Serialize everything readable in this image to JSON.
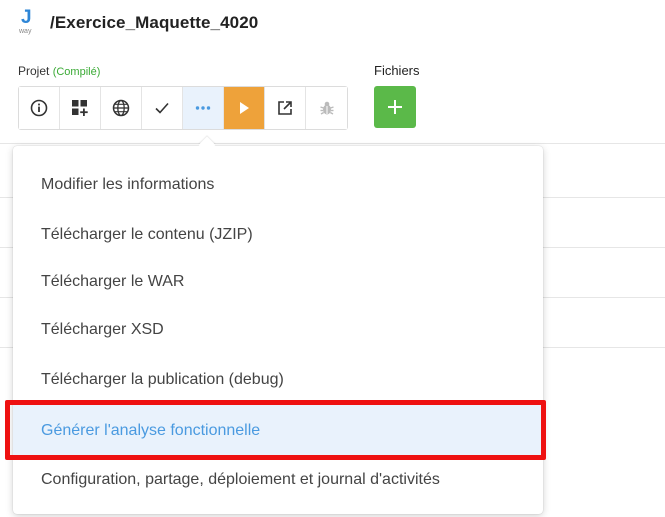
{
  "header": {
    "logo_letter": "J",
    "logo_sub": "way",
    "title": "/Exercice_Maquette_4020"
  },
  "sections": {
    "projet_label": "Projet",
    "projet_status": "(Compilé)",
    "fichiers_label": "Fichiers"
  },
  "toolbar": {
    "buttons": [
      {
        "icon": "info-icon"
      },
      {
        "icon": "add-widget-icon"
      },
      {
        "icon": "globe-icon"
      },
      {
        "icon": "checkmark-icon"
      },
      {
        "icon": "more-icon",
        "active": true
      },
      {
        "icon": "play-icon"
      },
      {
        "icon": "open-external-icon"
      },
      {
        "icon": "bug-icon",
        "disabled": true
      }
    ]
  },
  "fichiers": {
    "add_icon": "plus-icon"
  },
  "menu": {
    "items": [
      "Modifier les informations",
      "Télécharger le contenu (JZIP)",
      "Télécharger le WAR",
      "Télécharger XSD",
      "Télécharger la publication (debug)",
      "Générer l'analyse fonctionnelle",
      "Configuration, partage, déploiement et journal d'activités"
    ],
    "highlighted_index": 5
  },
  "colors": {
    "accent_blue": "#4a9ae0",
    "run_orange": "#eea23a",
    "add_green": "#5bb949",
    "compiled_green": "#3aaa35",
    "highlight_red": "#ee1111"
  }
}
